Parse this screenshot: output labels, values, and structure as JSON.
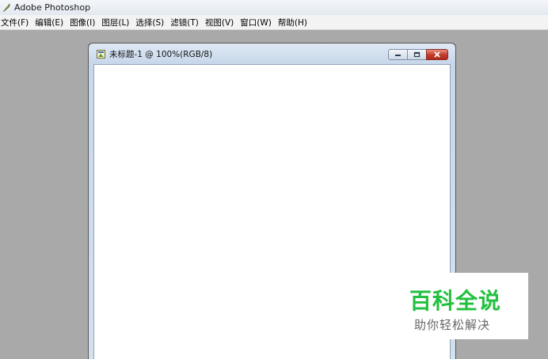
{
  "app": {
    "title": "Adobe Photoshop",
    "icon": "feather-icon"
  },
  "menu": {
    "items": [
      {
        "label": "文件(F)"
      },
      {
        "label": "编辑(E)"
      },
      {
        "label": "图像(I)"
      },
      {
        "label": "图层(L)"
      },
      {
        "label": "选择(S)"
      },
      {
        "label": "滤镜(T)"
      },
      {
        "label": "视图(V)"
      },
      {
        "label": "窗口(W)"
      },
      {
        "label": "帮助(H)"
      }
    ]
  },
  "document": {
    "title": "未标题-1 @ 100%(RGB/8)",
    "icon": "document-icon",
    "controls": [
      "minimize-icon",
      "restore-icon",
      "close-icon"
    ]
  },
  "watermark": {
    "main": "百科全说",
    "sub": "助你轻松解决",
    "color": "#22c040"
  }
}
